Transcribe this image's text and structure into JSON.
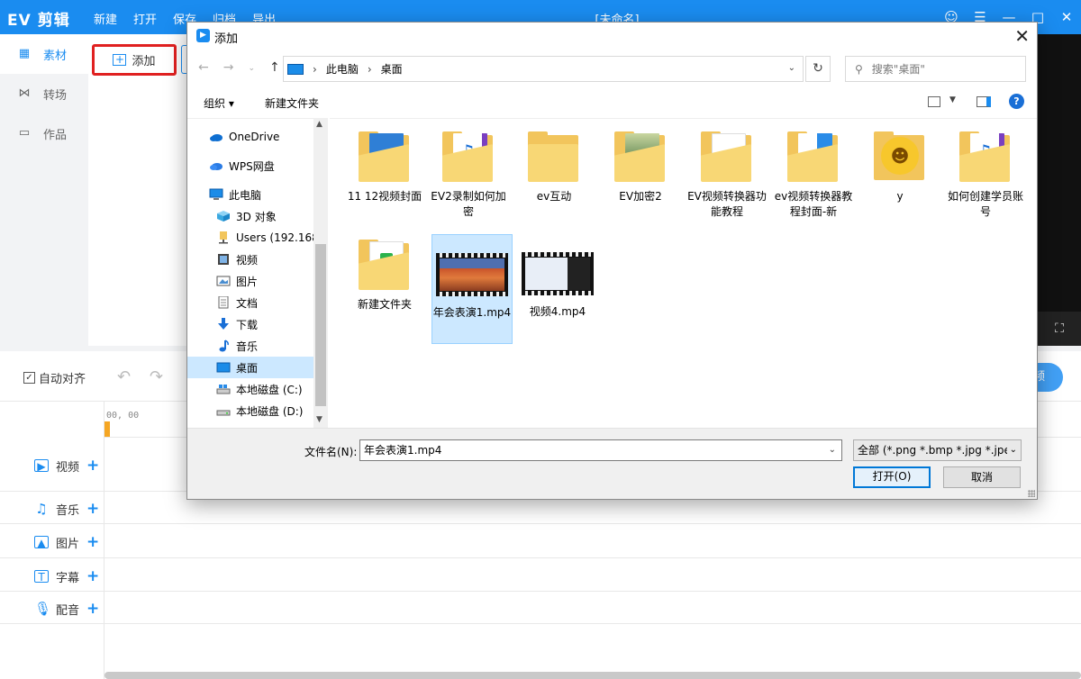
{
  "app": {
    "logo": "EV 剪辑",
    "menu": [
      "新建",
      "打开",
      "保存",
      "归档",
      "导出"
    ],
    "doc_title": "[未命名]"
  },
  "side_nav": [
    {
      "label": "素材",
      "active": true
    },
    {
      "label": "转场",
      "active": false
    },
    {
      "label": "作品",
      "active": false
    }
  ],
  "media": {
    "add_label": "添加"
  },
  "timeline": {
    "auto_align": "自动对齐",
    "auto_align_checked": true,
    "time_display": "00, 00",
    "export_partial": "频",
    "tracks": [
      {
        "label": "视频",
        "icon": "video-track-icon"
      },
      {
        "label": "音乐",
        "icon": "music-track-icon"
      },
      {
        "label": "图片",
        "icon": "image-track-icon"
      },
      {
        "label": "字幕",
        "icon": "subtitle-track-icon"
      },
      {
        "label": "配音",
        "icon": "voice-track-icon"
      }
    ]
  },
  "dialog": {
    "title": "添加",
    "address": [
      "此电脑",
      "桌面"
    ],
    "search_placeholder": "搜索\"桌面\"",
    "organize": "组织",
    "new_folder": "新建文件夹",
    "tree": [
      {
        "label": "OneDrive",
        "icon": "onedrive-icon",
        "level": 0
      },
      {
        "label": "WPS网盘",
        "icon": "wps-cloud-icon",
        "level": 0
      },
      {
        "label": "此电脑",
        "icon": "computer-icon",
        "level": 0
      },
      {
        "label": "3D 对象",
        "icon": "3d-objects-icon",
        "level": 1
      },
      {
        "label": "Users (192.168",
        "icon": "network-folder-icon",
        "level": 1
      },
      {
        "label": "视频",
        "icon": "videos-folder-icon",
        "level": 1
      },
      {
        "label": "图片",
        "icon": "pictures-folder-icon",
        "level": 1
      },
      {
        "label": "文档",
        "icon": "documents-folder-icon",
        "level": 1
      },
      {
        "label": "下载",
        "icon": "downloads-folder-icon",
        "level": 1
      },
      {
        "label": "音乐",
        "icon": "music-folder-icon",
        "level": 1
      },
      {
        "label": "桌面",
        "icon": "desktop-folder-icon",
        "level": 1,
        "selected": true
      },
      {
        "label": "本地磁盘 (C:)",
        "icon": "disk-c-icon",
        "level": 1
      },
      {
        "label": "本地磁盘 (D:)",
        "icon": "disk-d-icon",
        "level": 1
      }
    ],
    "files": [
      {
        "name": "11 12视频封面",
        "kind": "folder",
        "doc": "blue"
      },
      {
        "name": "EV2录制如何加密",
        "kind": "folder",
        "doc": "music"
      },
      {
        "name": "ev互动",
        "kind": "folder",
        "doc": "none"
      },
      {
        "name": "EV加密2",
        "kind": "folder",
        "doc": "photo"
      },
      {
        "name": "EV视频转换器功能教程",
        "kind": "folder",
        "doc": "white"
      },
      {
        "name": "ev视频转换器教程封面-新",
        "kind": "folder",
        "doc": "blue2"
      },
      {
        "name": "y",
        "kind": "folder",
        "doc": "emoji"
      },
      {
        "name": "如何创建学员账号",
        "kind": "folder",
        "doc": "music"
      },
      {
        "name": "新建文件夹",
        "kind": "folder",
        "doc": "green"
      },
      {
        "name": "年会表演1.mp4",
        "kind": "video",
        "selected": true
      },
      {
        "name": "视频4.mp4",
        "kind": "video2"
      }
    ],
    "filename_label": "文件名(N):",
    "filename_value": "年会表演1.mp4",
    "filetype": "全部 (*.png *.bmp *.jpg *.jpe",
    "open_label": "打开(O)",
    "cancel_label": "取消"
  },
  "colors": {
    "brand": "#1a8cf0",
    "highlight_border": "#e02020",
    "selection": "#cce8ff"
  }
}
